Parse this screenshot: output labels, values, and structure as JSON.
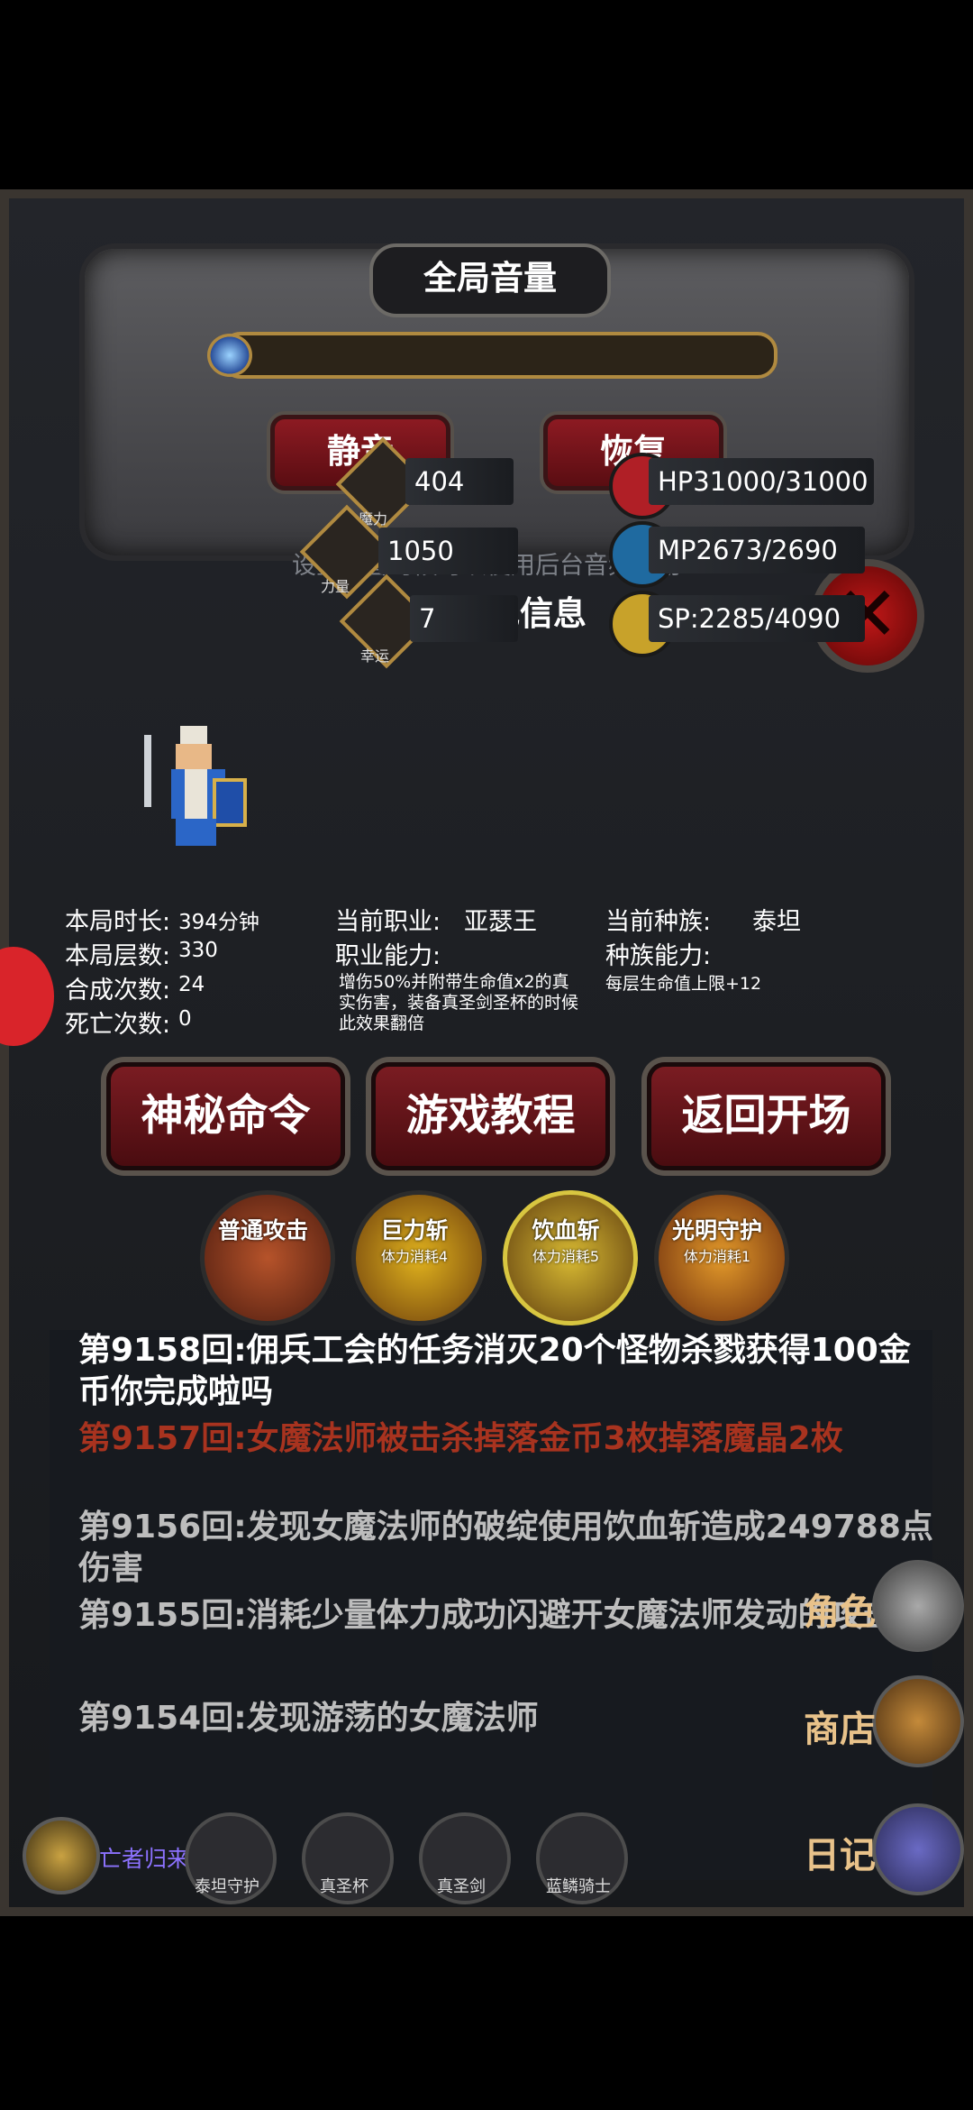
{
  "volume": {
    "title": "全局音量",
    "mute": "静音",
    "restore": "恢复",
    "hint": "设置静音时候可以使用后台音频应用",
    "level": 0
  },
  "character": {
    "section_title": "当前角色信息",
    "stats": {
      "magic": {
        "label": "魔力",
        "value": "404"
      },
      "power": {
        "label": "力量",
        "value": "1050"
      },
      "luck": {
        "label": "幸运",
        "value": "7"
      },
      "hp": "HP31000/31000",
      "mp": "MP2673/2690",
      "sp": "SP:2285/4090"
    },
    "run": {
      "time_label": "本局时长:",
      "time_value": "394分钟",
      "floors_label": "本局层数:",
      "floors_value": "330",
      "craft_label": "合成次数:",
      "craft_value": "24",
      "death_label": "死亡次数:",
      "death_value": "0"
    },
    "job": {
      "label": "当前职业:",
      "value": "亚瑟王",
      "ability_label": "职业能力:",
      "ability_text": "增伤50%并附带生命值x2的真实伤害，装备真圣剑圣杯的时候此效果翻倍"
    },
    "race": {
      "label": "当前种族:",
      "value": "泰坦",
      "ability_label": "种族能力:",
      "ability_text": "每层生命值上限+12"
    }
  },
  "actions": {
    "secret": "神秘命令",
    "tutorial": "游戏教程",
    "back": "返回开场"
  },
  "skills": [
    {
      "name": "普通攻击",
      "cost": ""
    },
    {
      "name": "巨力斩",
      "cost": "体力消耗4"
    },
    {
      "name": "饮血斩",
      "cost": "体力消耗5"
    },
    {
      "name": "光明守护",
      "cost": "体力消耗1"
    }
  ],
  "log": [
    {
      "text": "第9158回:佣兵工会的任务消灭20个怪物杀戮获得100金币你完成啦吗",
      "color": "#ffffff"
    },
    {
      "text": "第9157回:女魔法师被击杀掉落金币3枚掉落魔晶2枚",
      "color": "#a8331f"
    },
    {
      "text": "第9156回:发现女魔法师的破绽使用饮血斩造成249788点伤害",
      "color": "#bdbdbd"
    },
    {
      "text": "第9155回:消耗少量体力成功闪避开女魔法师发动的攻击",
      "color": "#bdbdbd"
    },
    {
      "text": "第9154回:发现游荡的女魔法师",
      "color": "#bdbdbd"
    }
  ],
  "side": {
    "role": "角色",
    "shop": "商店",
    "diary": "日记"
  },
  "bottom": {
    "undead": "亡者归来",
    "items": [
      "泰坦守护",
      "真圣杯",
      "真圣剑",
      "蓝鳞骑士"
    ]
  },
  "colors": {
    "accent": "#b08a40",
    "danger": "#8c1a22"
  }
}
